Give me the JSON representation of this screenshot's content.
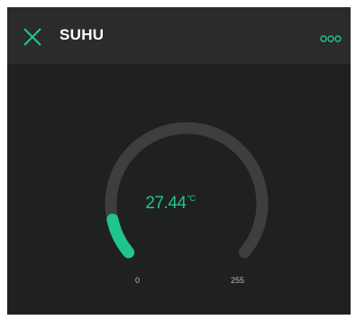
{
  "header": {
    "title": "SUHU",
    "close_icon": "close-icon",
    "more_icon": "more-options-icon"
  },
  "gauge": {
    "value": 27.44,
    "value_text": "27.44",
    "unit": "°C",
    "min": 0,
    "max": 255,
    "min_label": "0",
    "max_label": "255"
  },
  "colors": {
    "accent": "#20c58a",
    "background": "#1f2022",
    "header_background": "#2a2b2d",
    "track": "#3d3e40"
  }
}
